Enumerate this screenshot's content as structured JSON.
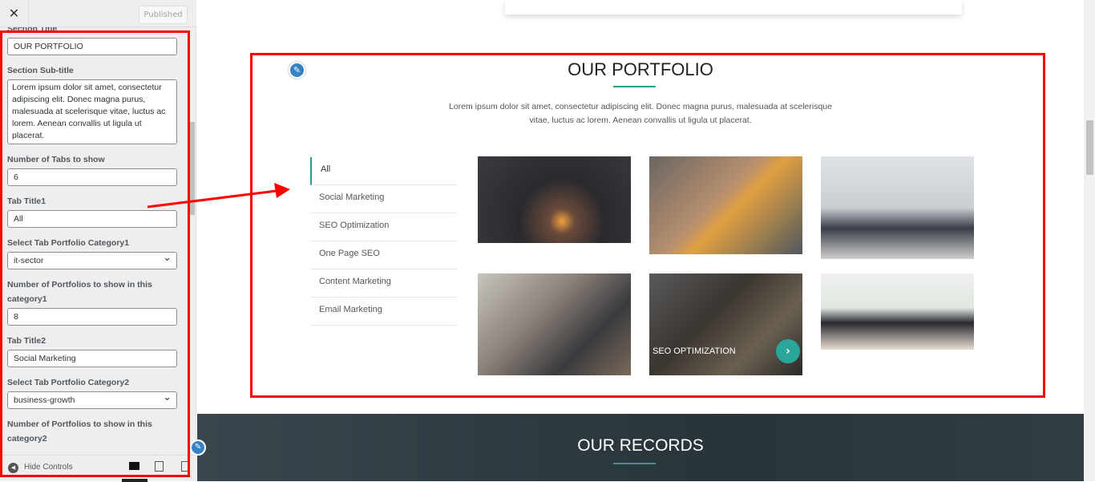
{
  "sidebar": {
    "close_icon": "close-icon",
    "published_label": "Published",
    "partial_label": "Section Title",
    "section_title_value": "OUR PORTFOLIO",
    "subtitle_label": "Section Sub-title",
    "subtitle_value": "Lorem ipsum dolor sit amet, consectetur adipiscing elit. Donec magna purus, malesuada at scelerisque vitae, luctus ac lorem. Aenean convallis ut ligula ut placerat.",
    "tabs_count_label": "Number of Tabs to show",
    "tabs_count_value": "6",
    "tab1_label": "Tab Title1",
    "tab1_value": "All",
    "cat1_label": "Select Tab Portfolio Category1",
    "cat1_value": "it-sector",
    "num1_label": "Number of Portfolios to show in this category1",
    "num1_value": "8",
    "tab2_label": "Tab Title2",
    "tab2_value": "Social Marketing",
    "cat2_label": "Select Tab Portfolio Category2",
    "cat2_value": "business-growth",
    "num2_label": "Number of Portfolios to show in this category2",
    "hide_controls": "Hide Controls"
  },
  "preview": {
    "title": "OUR PORTFOLIO",
    "subtitle": "Lorem ipsum dolor sit amet, consectetur adipiscing elit. Donec magna purus, malesuada at scelerisque vitae, luctus ac lorem. Aenean convallis ut ligula ut placerat.",
    "tabs": [
      "All",
      "Social Marketing",
      "SEO Optimization",
      "One Page SEO",
      "Content Marketing",
      "Email Marketing"
    ],
    "hover_caption": "SEO OPTIMIZATION",
    "records_title": "OUR RECORDS"
  },
  "colors": {
    "accent": "#2a9d8f",
    "highlight": "#ff0000",
    "edit": "#3582c4"
  }
}
